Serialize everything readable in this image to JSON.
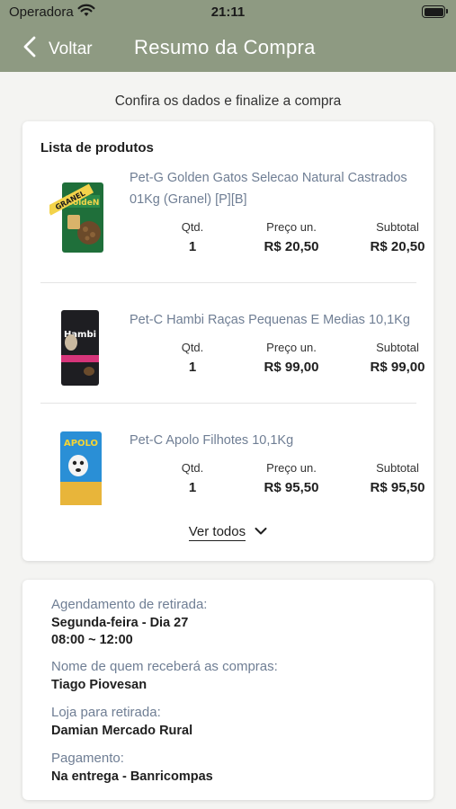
{
  "status_bar": {
    "carrier": "Operadora",
    "time": "21:11"
  },
  "nav": {
    "back_label": "Voltar",
    "title": "Resumo da Compra"
  },
  "subtitle": "Confira os dados e finalize a compra",
  "products_card": {
    "title": "Lista de produtos",
    "col_qty": "Qtd.",
    "col_price": "Preço un.",
    "col_subtotal": "Subtotal",
    "items": [
      {
        "name": "Pet-G Golden Gatos Selecao Natural Castrados 01Kg (Granel) [P][B]",
        "qty": "1",
        "price": "R$ 20,50",
        "subtotal": "R$ 20,50",
        "banner": "GRANEL",
        "brand": "GoldeN"
      },
      {
        "name": "Pet-C Hambi Raças Pequenas E Medias 10,1Kg",
        "qty": "1",
        "price": "R$ 99,00",
        "subtotal": "R$ 99,00",
        "brand": "Hambi"
      },
      {
        "name": "Pet-C Apolo Filhotes 10,1Kg",
        "qty": "1",
        "price": "R$ 95,50",
        "subtotal": "R$ 95,50",
        "brand": "APOLO"
      }
    ],
    "ver_todos": "Ver todos"
  },
  "info_card": {
    "schedule_label": "Agendamento de retirada:",
    "schedule_day": "Segunda-feira - Dia 27",
    "schedule_time": "08:00 ~ 12:00",
    "receiver_label": "Nome de quem receberá as compras:",
    "receiver_value": "Tiago Piovesan",
    "store_label": "Loja para retirada:",
    "store_value": "Damian Mercado Rural",
    "payment_label": "Pagamento:",
    "payment_value": "Na entrega - Banricompas"
  },
  "colors": {
    "header": "#8e9a82",
    "product_name": "#6f7e94",
    "label": "#6f7e94"
  }
}
